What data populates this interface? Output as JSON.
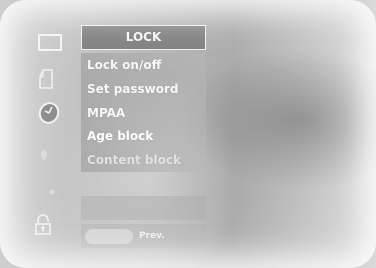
{
  "menu": {
    "title": "LOCK",
    "items": [
      {
        "label": "Lock on/off"
      },
      {
        "label": "Set password"
      },
      {
        "label": "MPAA"
      },
      {
        "label": "Age block"
      },
      {
        "label": "Content block"
      }
    ]
  },
  "sidebar": {
    "icons": [
      "screen-icon",
      "audio-icon",
      "time-icon",
      "option-icon",
      "setup-icon",
      "lock-icon"
    ]
  },
  "footer": {
    "prev_label": "Prev."
  },
  "colors": {
    "header_bg": "#7e7e7e",
    "text": "#f7f7f7"
  }
}
